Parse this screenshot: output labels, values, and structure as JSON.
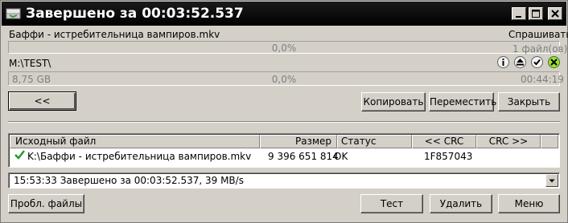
{
  "title": "Завершено за 00:03:52.537",
  "source": {
    "file_name": "Баффи - истребительница вампиров.mkv",
    "prompt": "Спрашивать",
    "percent": "0,0%",
    "files": "1 файл(ов)"
  },
  "dest": {
    "path": "M:\\TEST\\",
    "size": "8,75 GB",
    "percent": "0,0%",
    "time": "00:44:19"
  },
  "buttons": {
    "back": "<<",
    "copy": "Копировать",
    "move": "Переместить",
    "close": "Закрыть",
    "test_files": "Пробл. файлы",
    "test": "Тест",
    "delete": "Удалить",
    "menu": "Меню"
  },
  "table": {
    "headers": {
      "source": "Исходный файл",
      "size": "Размер",
      "status": "Статус",
      "crc_left": "<< CRC",
      "crc_right": "CRC >>"
    },
    "rows": [
      {
        "file": "K:\\Баффи - истребительница вампиров.mkv",
        "size": "9 396 651 814",
        "status": "OK",
        "crc": "1F857043"
      }
    ]
  },
  "log": {
    "selected": "15:53:33 Завершено за 00:03:52.537, 39 MB/s"
  },
  "colors": {
    "titlebar": "#000000",
    "face": "#d4d0c8",
    "check": "#2a9a2a"
  },
  "icons": [
    "app-icon",
    "minimize-icon",
    "maximize-icon",
    "close-icon",
    "info-icon",
    "eject-icon",
    "check-icon",
    "cancel-icon",
    "success-check-icon",
    "dropdown-arrow-icon"
  ]
}
